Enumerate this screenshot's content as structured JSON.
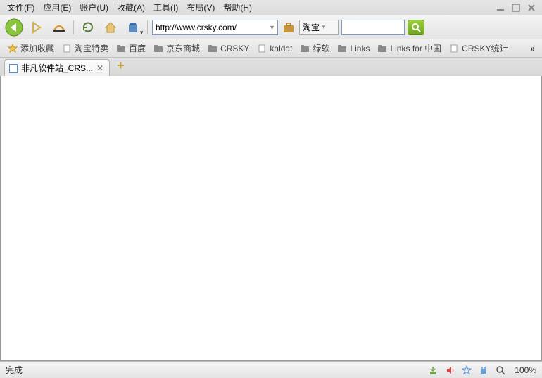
{
  "menubar": {
    "items": [
      "文件(F)",
      "应用(E)",
      "账户(U)",
      "收藏(A)",
      "工具(I)",
      "布局(V)",
      "帮助(H)"
    ]
  },
  "toolbar": {
    "url": "http://www.crsky.com/"
  },
  "search": {
    "engine": "淘宝",
    "placeholder": ""
  },
  "bookmarks": {
    "items": [
      {
        "label": "添加收藏",
        "icon": "star"
      },
      {
        "label": "淘宝特卖",
        "icon": "page"
      },
      {
        "label": "百度",
        "icon": "folder"
      },
      {
        "label": "京东商城",
        "icon": "folder"
      },
      {
        "label": "CRSKY",
        "icon": "folder"
      },
      {
        "label": "kaldat",
        "icon": "page"
      },
      {
        "label": "绿软",
        "icon": "folder"
      },
      {
        "label": "Links",
        "icon": "folder"
      },
      {
        "label": "Links for 中国",
        "icon": "folder"
      },
      {
        "label": "CRSKY统计",
        "icon": "page"
      }
    ]
  },
  "tabs": {
    "active": {
      "title": "非凡软件站_CRS..."
    }
  },
  "statusbar": {
    "text": "完成",
    "zoom": "100%"
  }
}
